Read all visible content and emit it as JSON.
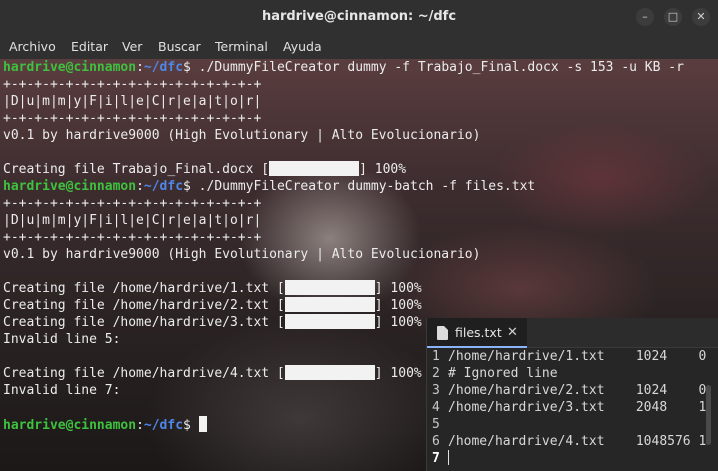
{
  "window": {
    "title": "hardrive@cinnamon: ~/dfc",
    "controls": {
      "minimize_icon": "minimize-icon",
      "maximize_icon": "maximize-icon",
      "close_icon": "close-icon"
    }
  },
  "menu": [
    "Archivo",
    "Editar",
    "Ver",
    "Buscar",
    "Terminal",
    "Ayuda"
  ],
  "prompt": {
    "user_host": "hardrive@cinnamon",
    "colon": ":",
    "path": "~/dfc",
    "symbol": "$"
  },
  "commands": [
    " ./DummyFileCreator dummy -f Trabajo_Final.docx -s 153 -u KB -r",
    " ./DummyFileCreator dummy-batch -f files.txt"
  ],
  "banner": {
    "border": "+-+-+-+-+-+-+-+-+-+-+-+-+-+-+-+-+",
    "letters": "|D|u|m|m|y|F|i|l|e|C|r|e|a|t|o|r|",
    "version": "v0.1 by hardrive9000 (High Evolutionary | Alto Evolucionario)"
  },
  "output": {
    "create1": "Creating file Trabajo_Final.docx",
    "batch": [
      "Creating file /home/hardrive/1.txt",
      "Creating file /home/hardrive/2.txt",
      "Creating file /home/hardrive/3.txt",
      "Invalid line 5:",
      "Creating file /home/hardrive/4.txt",
      "Invalid line 7:"
    ],
    "progress_percent": "100%",
    "progress_blocks": 9
  },
  "editor": {
    "tab_name": "files.txt",
    "tab_close": "✕",
    "lines": [
      {
        "n": "1",
        "text": "/home/hardrive/1.txt    1024    0"
      },
      {
        "n": "2",
        "text": "# Ignored line"
      },
      {
        "n": "3",
        "text": "/home/hardrive/2.txt    1024    0"
      },
      {
        "n": "4",
        "text": "/home/hardrive/3.txt    2048    1"
      },
      {
        "n": "5",
        "text": ""
      },
      {
        "n": "6",
        "text": "/home/hardrive/4.txt    1048576 1"
      },
      {
        "n": "7",
        "text": ""
      }
    ]
  },
  "colors": {
    "prompt_user": "#3ec13e",
    "prompt_path": "#4f87e8",
    "text": "#ececec",
    "chrome": "#303030"
  }
}
